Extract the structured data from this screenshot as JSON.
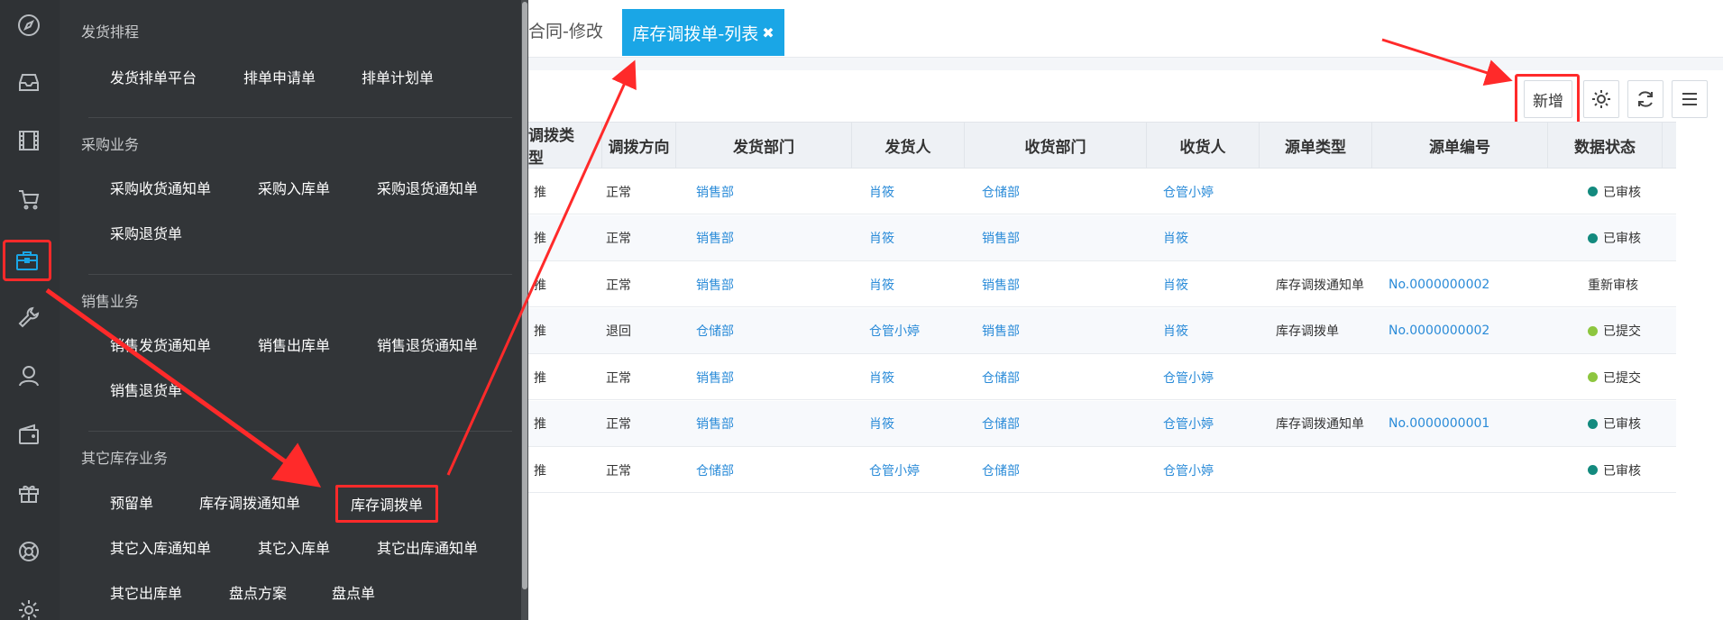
{
  "rail": {
    "icons": [
      "compass-icon",
      "inbox-icon",
      "film-icon",
      "cart-icon",
      "briefcase-icon",
      "wrench-icon",
      "user-icon",
      "wallet-icon",
      "gift-icon",
      "lifebuoy-icon",
      "gear-icon"
    ]
  },
  "menu": {
    "groups": [
      {
        "title": "发货排程",
        "items": [
          "发货排单平台",
          "排单申请单",
          "排单计划单"
        ]
      },
      {
        "title": "采购业务",
        "items": [
          "采购收货通知单",
          "采购入库单",
          "采购退货通知单",
          "采购退货单"
        ]
      },
      {
        "title": "销售业务",
        "items": [
          "销售发货通知单",
          "销售出库单",
          "销售退货通知单",
          "销售退货单"
        ]
      },
      {
        "title": "其它库存业务",
        "items": [
          "预留单",
          "库存调拨通知单",
          "库存调拨单",
          "其它入库通知单",
          "其它入库单",
          "其它出库通知单",
          "其它出库单",
          "盘点方案",
          "盘点单"
        ]
      }
    ]
  },
  "tabs": {
    "previous": "合同-修改",
    "active": "库存调拨单-列表",
    "close_glyph": "✖"
  },
  "toolbar": {
    "new_label": "新增"
  },
  "table": {
    "headers": [
      "调拨类型",
      "调拨方向",
      "发货部门",
      "发货人",
      "收货部门",
      "收货人",
      "源单类型",
      "源单编号",
      "数据状态"
    ],
    "rows": [
      {
        "type": "推",
        "direction": "正常",
        "send_dept": "销售部",
        "sender": "肖筱",
        "recv_dept": "仓储部",
        "receiver": "仓管小婷",
        "src_type": "",
        "src_no": "",
        "status": "已审核",
        "status_color": "#138a7e"
      },
      {
        "type": "推",
        "direction": "正常",
        "send_dept": "销售部",
        "sender": "肖筱",
        "recv_dept": "销售部",
        "receiver": "肖筱",
        "src_type": "",
        "src_no": "",
        "status": "已审核",
        "status_color": "#138a7e"
      },
      {
        "type": "推",
        "direction": "正常",
        "send_dept": "销售部",
        "sender": "肖筱",
        "recv_dept": "销售部",
        "receiver": "肖筱",
        "src_type": "库存调拨通知单",
        "src_no": "No.0000000002",
        "status": "重新审核",
        "status_color": ""
      },
      {
        "type": "推",
        "direction": "退回",
        "send_dept": "仓储部",
        "sender": "仓管小婷",
        "recv_dept": "销售部",
        "receiver": "肖筱",
        "src_type": "库存调拨单",
        "src_no": "No.0000000002",
        "status": "已提交",
        "status_color": "#8dc63f"
      },
      {
        "type": "推",
        "direction": "正常",
        "send_dept": "销售部",
        "sender": "肖筱",
        "recv_dept": "仓储部",
        "receiver": "仓管小婷",
        "src_type": "",
        "src_no": "",
        "status": "已提交",
        "status_color": "#8dc63f"
      },
      {
        "type": "推",
        "direction": "正常",
        "send_dept": "销售部",
        "sender": "肖筱",
        "recv_dept": "仓储部",
        "receiver": "仓管小婷",
        "src_type": "库存调拨通知单",
        "src_no": "No.0000000001",
        "status": "已审核",
        "status_color": "#138a7e"
      },
      {
        "type": "推",
        "direction": "正常",
        "send_dept": "仓储部",
        "sender": "仓管小婷",
        "recv_dept": "仓储部",
        "receiver": "仓管小婷",
        "src_type": "",
        "src_no": "",
        "status": "已审核",
        "status_color": "#138a7e"
      }
    ]
  },
  "colors": {
    "accent": "#1aa6e6",
    "annotation": "#ff2a2a",
    "link": "#2a8bd8",
    "sidebar": "#2f3235"
  }
}
